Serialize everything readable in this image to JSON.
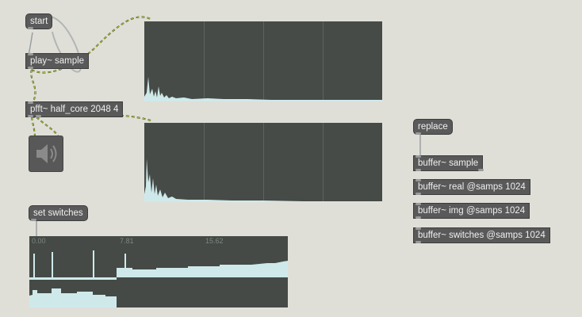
{
  "patcher": {
    "objects": {
      "start": "start",
      "play": "play~ sample",
      "pfft": "pfft~ half_core 2048 4",
      "set_switches": "set switches",
      "replace": "replace",
      "buffer_sample": "buffer~ sample",
      "buffer_real": "buffer~ real @samps 1024",
      "buffer_img": "buffer~ img @samps 1024",
      "buffer_switches": "buffer~ switches @samps 1024"
    },
    "table_axis_ticks": [
      "0.00",
      "7.81",
      "15.62"
    ],
    "icons": {
      "speaker": "speaker-icon"
    }
  },
  "colors": {
    "background": "#dfdfd8",
    "object_fill": "#595959",
    "scope_bg": "#464b47",
    "spectrum": "#cfe9ea",
    "patch_cord_signal": "#5c6b18"
  }
}
